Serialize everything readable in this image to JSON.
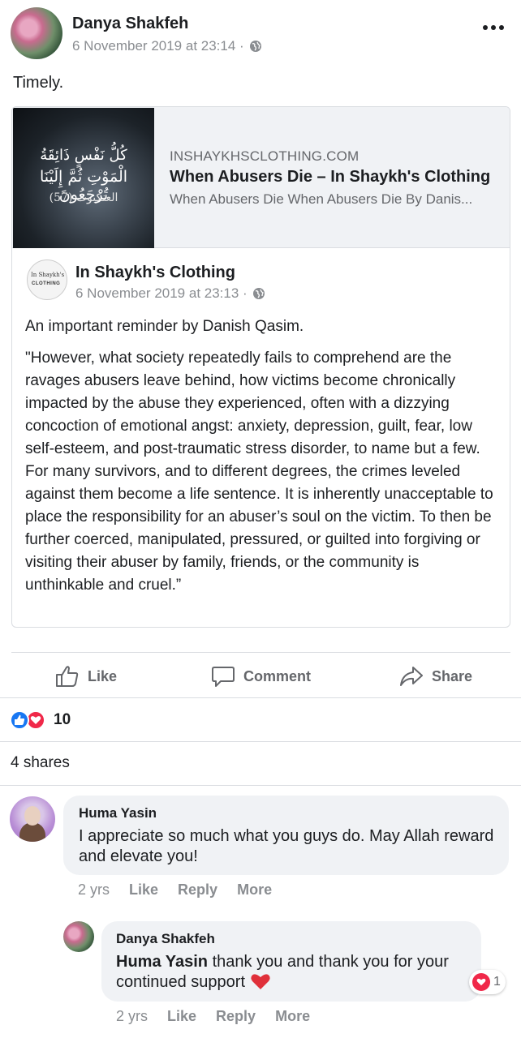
{
  "post": {
    "author": "Danya Shakfeh",
    "timestamp": "6 November 2019 at 23:14 ·",
    "text": "Timely."
  },
  "shared_link": {
    "thumbnail_arabic": {
      "line1": "كُلُّ نَفْسٍ ذَائِقَةُ",
      "line2": "الْمَوْتِ ثُمَّ إِلَيْنَا تُرْجَعُونَ",
      "line3": "العنكبوت (57)"
    },
    "domain": "INSHAYKHSCLOTHING.COM",
    "title": "When Abusers Die – In Shaykh's Clothing",
    "description": "When Abusers Die When Abusers Die By Danis..."
  },
  "shared_post": {
    "page_name": "In Shaykh's Clothing",
    "page_avatar_text1": "In Shaykh's",
    "page_avatar_text2": "CLOTHING",
    "timestamp": "6 November 2019 at 23:13 ·",
    "intro": "An important reminder by Danish Qasim.",
    "quote": "\"However, what society repeatedly fails to comprehend are the ravages abusers leave behind, how victims become chronically impacted by the abuse they experienced, often with a dizzying concoction of emotional angst: anxiety, depression, guilt, fear, low self-esteem, and post-traumatic stress disorder, to name but a few. For many survivors, and to different degrees, the crimes leveled against them become a life sentence. It is inherently unacceptable to place the responsibility for an abuser’s soul on the victim. To then be further coerced, manipulated, pressured, or guilted into forgiving or visiting their abuser by family, friends, or the community is unthinkable and cruel.”"
  },
  "actions": {
    "like": "Like",
    "comment": "Comment",
    "share": "Share"
  },
  "reactions": {
    "count": "10",
    "icons": [
      "like-reaction-icon",
      "love-reaction-icon"
    ]
  },
  "shares": "4 shares",
  "comments": [
    {
      "name": "Huma Yasin",
      "text": "I appreciate so much what you guys do. May Allah reward and elevate you!",
      "time": "2 yrs",
      "like": "Like",
      "reply": "Reply",
      "more": "More"
    }
  ],
  "reply": {
    "name": "Danya Shakfeh",
    "mention": "Huma Yasin",
    "text": " thank you and thank you for your continued support",
    "time": "2 yrs",
    "like": "Like",
    "reply": "Reply",
    "more": "More",
    "reaction_count": "1"
  },
  "colors": {
    "facebook_blue": "#1877f2",
    "love_red": "#f02849",
    "meta_grey": "#8a8d91",
    "bubble_bg": "#f0f2f5"
  }
}
